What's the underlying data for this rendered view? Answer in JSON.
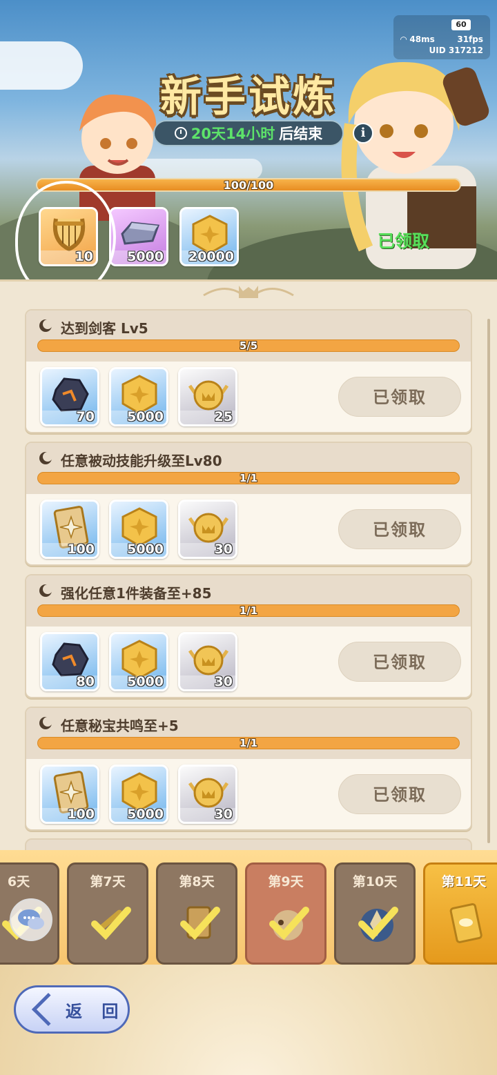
{
  "status": {
    "fps_badge": "60",
    "ping": "48ms",
    "fps": "31fps",
    "uid": "UID 317212"
  },
  "header": {
    "title": "新手试炼",
    "timer_green": "20天14小时",
    "timer_white": "后结束",
    "info_label": "i",
    "progress_text": "100/100",
    "progress_value": 1.0,
    "claimed_label": "已领取"
  },
  "top_rewards": [
    {
      "icon": "lyre-icon",
      "count": "10",
      "rarity": "orange"
    },
    {
      "icon": "ingot-icon",
      "count": "5000",
      "rarity": "purple"
    },
    {
      "icon": "gold-coin-icon",
      "count": "20000",
      "rarity": "blue"
    }
  ],
  "tasks": [
    {
      "name": "达到剑客  Lv5",
      "progress": "5/5",
      "rewards": [
        {
          "icon": "ore-icon",
          "count": "70"
        },
        {
          "icon": "gold-coin-icon",
          "count": "5000"
        },
        {
          "icon": "winged-token-icon",
          "count": "25"
        }
      ],
      "button": "已领取"
    },
    {
      "name": "任意被动技能升级至Lv80",
      "progress": "1/1",
      "rewards": [
        {
          "icon": "card-icon",
          "count": "100"
        },
        {
          "icon": "gold-coin-icon",
          "count": "5000"
        },
        {
          "icon": "winged-token-icon",
          "count": "30"
        }
      ],
      "button": "已领取"
    },
    {
      "name": "强化任意1件装备至+85",
      "progress": "1/1",
      "rewards": [
        {
          "icon": "ore-icon",
          "count": "80"
        },
        {
          "icon": "gold-coin-icon",
          "count": "5000"
        },
        {
          "icon": "winged-token-icon",
          "count": "30"
        }
      ],
      "button": "已领取"
    },
    {
      "name": "任意秘宝共鸣至+5",
      "progress": "1/1",
      "rewards": [
        {
          "icon": "card-icon",
          "count": "100"
        },
        {
          "icon": "gold-coin-icon",
          "count": "5000"
        },
        {
          "icon": "winged-token-icon",
          "count": "30"
        }
      ],
      "button": "已领取"
    }
  ],
  "days": [
    {
      "label": "6天",
      "state": "done"
    },
    {
      "label": "第7天",
      "state": "done"
    },
    {
      "label": "第8天",
      "state": "done"
    },
    {
      "label": "第9天",
      "state": "selected"
    },
    {
      "label": "第10天",
      "state": "done"
    },
    {
      "label": "第11天",
      "state": "current"
    }
  ],
  "back_button": "返 回",
  "colors": {
    "accent_orange": "#f3a543",
    "claimed_green": "#58df5a",
    "timer_green": "#5de36a",
    "back_blue": "#4e69b8"
  }
}
